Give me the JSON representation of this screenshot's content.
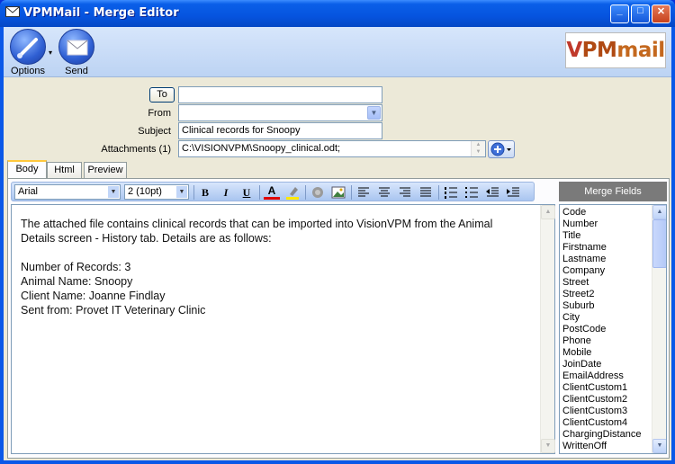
{
  "window": {
    "title": "VPMMail - Merge Editor",
    "minimize": "_",
    "maximize": "□",
    "close": "✕"
  },
  "toolbar": {
    "options_label": "Options",
    "send_label": "Send",
    "logo_v": "V",
    "logo_pm": "PM",
    "logo_mail": "mail"
  },
  "form": {
    "to_label": "To",
    "to_value": "",
    "from_label": "From",
    "from_value": "",
    "subject_label": "Subject",
    "subject_value": "Clinical records for Snoopy",
    "attachments_label": "Attachments (1)",
    "attachments_value": "C:\\VISIONVPM\\Snoopy_clinical.odt;"
  },
  "tabs": [
    {
      "label": "Body",
      "active": true
    },
    {
      "label": "Html",
      "active": false
    },
    {
      "label": "Preview",
      "active": false
    }
  ],
  "format": {
    "font": "Arial",
    "size": "2 (10pt)",
    "bold": "B",
    "italic": "I",
    "underline": "U",
    "font_color": "A"
  },
  "editor": {
    "line1": "The attached file contains clinical records that can be imported into VisionVPM from the Animal",
    "line2": "Details screen - History tab. Details are as follows:",
    "line3": "Number of Records: 3",
    "line4": "Animal Name: Snoopy",
    "line5": "Client Name: Joanne Findlay",
    "line6": "Sent from: Provet IT Veterinary Clinic"
  },
  "merge_fields": {
    "header": "Merge Fields",
    "items": [
      "Code",
      "Number",
      "Title",
      "Firstname",
      "Lastname",
      "Company",
      "Street",
      "Street2",
      "Suburb",
      "City",
      "PostCode",
      "Phone",
      "Mobile",
      "JoinDate",
      "EmailAddress",
      "ClientCustom1",
      "ClientCustom2",
      "ClientCustom3",
      "ClientCustom4",
      "ChargingDistance",
      "WrittenOff"
    ]
  },
  "colors": {
    "titlebar": "#0654df",
    "toolbar": "#c6dbf7",
    "client_bg": "#ece9d8"
  }
}
